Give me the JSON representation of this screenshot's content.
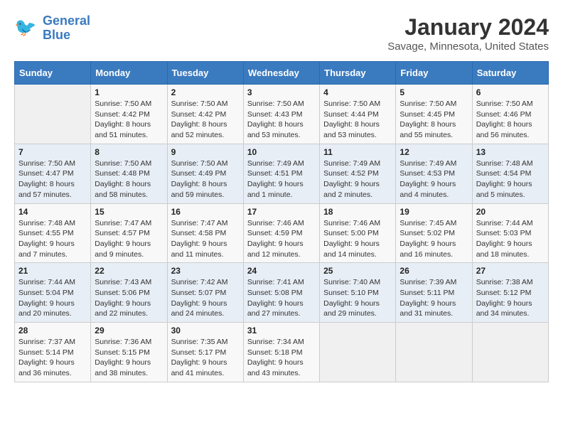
{
  "header": {
    "logo_line1": "General",
    "logo_line2": "Blue",
    "title": "January 2024",
    "subtitle": "Savage, Minnesota, United States"
  },
  "days_of_week": [
    "Sunday",
    "Monday",
    "Tuesday",
    "Wednesday",
    "Thursday",
    "Friday",
    "Saturday"
  ],
  "weeks": [
    [
      {
        "day": "",
        "info": ""
      },
      {
        "day": "1",
        "info": "Sunrise: 7:50 AM\nSunset: 4:42 PM\nDaylight: 8 hours\nand 51 minutes."
      },
      {
        "day": "2",
        "info": "Sunrise: 7:50 AM\nSunset: 4:42 PM\nDaylight: 8 hours\nand 52 minutes."
      },
      {
        "day": "3",
        "info": "Sunrise: 7:50 AM\nSunset: 4:43 PM\nDaylight: 8 hours\nand 53 minutes."
      },
      {
        "day": "4",
        "info": "Sunrise: 7:50 AM\nSunset: 4:44 PM\nDaylight: 8 hours\nand 53 minutes."
      },
      {
        "day": "5",
        "info": "Sunrise: 7:50 AM\nSunset: 4:45 PM\nDaylight: 8 hours\nand 55 minutes."
      },
      {
        "day": "6",
        "info": "Sunrise: 7:50 AM\nSunset: 4:46 PM\nDaylight: 8 hours\nand 56 minutes."
      }
    ],
    [
      {
        "day": "7",
        "info": "Sunrise: 7:50 AM\nSunset: 4:47 PM\nDaylight: 8 hours\nand 57 minutes."
      },
      {
        "day": "8",
        "info": "Sunrise: 7:50 AM\nSunset: 4:48 PM\nDaylight: 8 hours\nand 58 minutes."
      },
      {
        "day": "9",
        "info": "Sunrise: 7:50 AM\nSunset: 4:49 PM\nDaylight: 8 hours\nand 59 minutes."
      },
      {
        "day": "10",
        "info": "Sunrise: 7:49 AM\nSunset: 4:51 PM\nDaylight: 9 hours\nand 1 minute."
      },
      {
        "day": "11",
        "info": "Sunrise: 7:49 AM\nSunset: 4:52 PM\nDaylight: 9 hours\nand 2 minutes."
      },
      {
        "day": "12",
        "info": "Sunrise: 7:49 AM\nSunset: 4:53 PM\nDaylight: 9 hours\nand 4 minutes."
      },
      {
        "day": "13",
        "info": "Sunrise: 7:48 AM\nSunset: 4:54 PM\nDaylight: 9 hours\nand 5 minutes."
      }
    ],
    [
      {
        "day": "14",
        "info": "Sunrise: 7:48 AM\nSunset: 4:55 PM\nDaylight: 9 hours\nand 7 minutes."
      },
      {
        "day": "15",
        "info": "Sunrise: 7:47 AM\nSunset: 4:57 PM\nDaylight: 9 hours\nand 9 minutes."
      },
      {
        "day": "16",
        "info": "Sunrise: 7:47 AM\nSunset: 4:58 PM\nDaylight: 9 hours\nand 11 minutes."
      },
      {
        "day": "17",
        "info": "Sunrise: 7:46 AM\nSunset: 4:59 PM\nDaylight: 9 hours\nand 12 minutes."
      },
      {
        "day": "18",
        "info": "Sunrise: 7:46 AM\nSunset: 5:00 PM\nDaylight: 9 hours\nand 14 minutes."
      },
      {
        "day": "19",
        "info": "Sunrise: 7:45 AM\nSunset: 5:02 PM\nDaylight: 9 hours\nand 16 minutes."
      },
      {
        "day": "20",
        "info": "Sunrise: 7:44 AM\nSunset: 5:03 PM\nDaylight: 9 hours\nand 18 minutes."
      }
    ],
    [
      {
        "day": "21",
        "info": "Sunrise: 7:44 AM\nSunset: 5:04 PM\nDaylight: 9 hours\nand 20 minutes."
      },
      {
        "day": "22",
        "info": "Sunrise: 7:43 AM\nSunset: 5:06 PM\nDaylight: 9 hours\nand 22 minutes."
      },
      {
        "day": "23",
        "info": "Sunrise: 7:42 AM\nSunset: 5:07 PM\nDaylight: 9 hours\nand 24 minutes."
      },
      {
        "day": "24",
        "info": "Sunrise: 7:41 AM\nSunset: 5:08 PM\nDaylight: 9 hours\nand 27 minutes."
      },
      {
        "day": "25",
        "info": "Sunrise: 7:40 AM\nSunset: 5:10 PM\nDaylight: 9 hours\nand 29 minutes."
      },
      {
        "day": "26",
        "info": "Sunrise: 7:39 AM\nSunset: 5:11 PM\nDaylight: 9 hours\nand 31 minutes."
      },
      {
        "day": "27",
        "info": "Sunrise: 7:38 AM\nSunset: 5:12 PM\nDaylight: 9 hours\nand 34 minutes."
      }
    ],
    [
      {
        "day": "28",
        "info": "Sunrise: 7:37 AM\nSunset: 5:14 PM\nDaylight: 9 hours\nand 36 minutes."
      },
      {
        "day": "29",
        "info": "Sunrise: 7:36 AM\nSunset: 5:15 PM\nDaylight: 9 hours\nand 38 minutes."
      },
      {
        "day": "30",
        "info": "Sunrise: 7:35 AM\nSunset: 5:17 PM\nDaylight: 9 hours\nand 41 minutes."
      },
      {
        "day": "31",
        "info": "Sunrise: 7:34 AM\nSunset: 5:18 PM\nDaylight: 9 hours\nand 43 minutes."
      },
      {
        "day": "",
        "info": ""
      },
      {
        "day": "",
        "info": ""
      },
      {
        "day": "",
        "info": ""
      }
    ]
  ]
}
